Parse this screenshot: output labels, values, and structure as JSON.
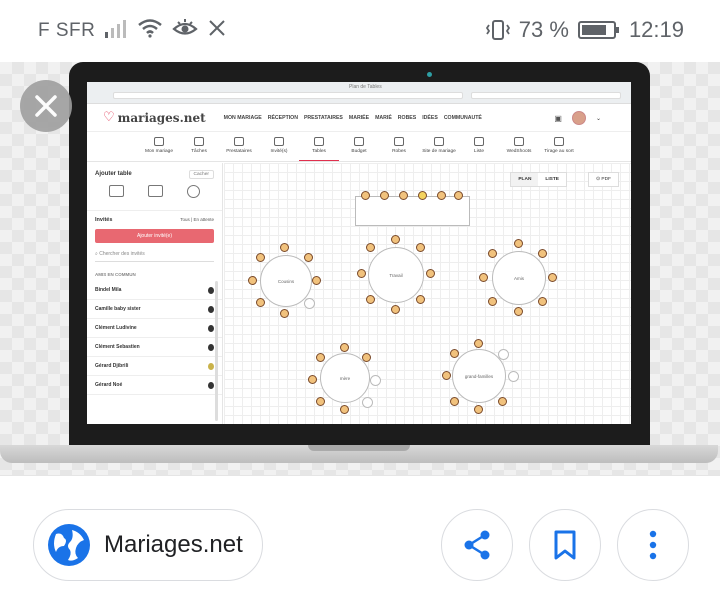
{
  "status_bar": {
    "carrier": "F SFR",
    "battery": "73 %",
    "time": "12:19"
  },
  "browser": {
    "tab_title": "Plan de Tables"
  },
  "site": {
    "logo_text": "mariages.net",
    "menu": [
      "MON MARIAGE",
      "RÉCEPTION",
      "PRESTATAIRES",
      "MARIÉE",
      "MARIÉ",
      "ROBES",
      "IDÉES",
      "COMMUNAUTÉ"
    ],
    "tools": [
      "Mon mariage",
      "Tâches",
      "Prestataires",
      "Invité(s)",
      "Tables",
      "Budget",
      "Robes",
      "Site de mariage",
      "Liste",
      "WedShoots",
      "Tirage au sort"
    ],
    "active_tool": "Tables"
  },
  "sidebar": {
    "title": "Ajouter table",
    "hide_label": "Cacher",
    "guests_label": "Invités",
    "filter_label": "Tous | En attente",
    "add_guest_label": "Ajouter invité(e)",
    "search_placeholder": "Chercher des invités",
    "group_label": "AMIS EN COMMUN",
    "guests": [
      "Bindel Mila",
      "Camille baby sister",
      "Clément Ludivine",
      "Clément Sebastien",
      "Gérard Djibrili",
      "Gérard Noé"
    ]
  },
  "canvas": {
    "view_plan": "PLAN",
    "view_list": "LISTE",
    "pdf_label": "PDF",
    "tables": [
      "Cousins",
      "Travail",
      "Amis",
      "mère",
      "grand-familles"
    ]
  },
  "share_sheet": {
    "site_name": "Mariages.net"
  },
  "colors": {
    "brand": "#e0304e",
    "add_button": "#e86871",
    "globe": "#1a73e8"
  }
}
